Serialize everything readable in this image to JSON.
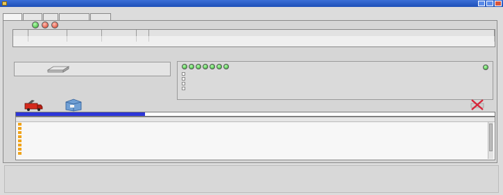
{
  "window": {
    "title": ""
  },
  "menu": [
    "",
    "",
    "",
    ""
  ],
  "tabs": [
    "",
    "",
    "",
    "",
    ""
  ],
  "status_row": {
    "label": "",
    "lights": [
      "green",
      "red",
      "red"
    ]
  },
  "grid": {
    "headers": [
      "",
      "",
      "",
      "",
      "",
      ""
    ],
    "rows": [
      [
        "",
        "",
        "",
        "",
        "",
        ""
      ]
    ]
  },
  "section_label": "",
  "drive": {
    "name": "",
    "info": [
      "",
      "",
      "",
      ""
    ]
  },
  "lights": {
    "count": 7,
    "color": "green"
  },
  "options": [
    {
      "label": "",
      "checked": false
    },
    {
      "label": "",
      "checked": false
    },
    {
      "label": "",
      "checked": false
    },
    {
      "label": "",
      "checked": false
    }
  ],
  "progress": {
    "fraction": 0.27,
    "message": ""
  },
  "log": {
    "header": "",
    "rows": [
      "",
      "",
      "",
      "",
      "",
      "",
      "",
      ""
    ]
  },
  "colors": {
    "titlebar": "#1d4fb8",
    "progress": "#2d36d8",
    "log_icon": "#f0a31a"
  }
}
